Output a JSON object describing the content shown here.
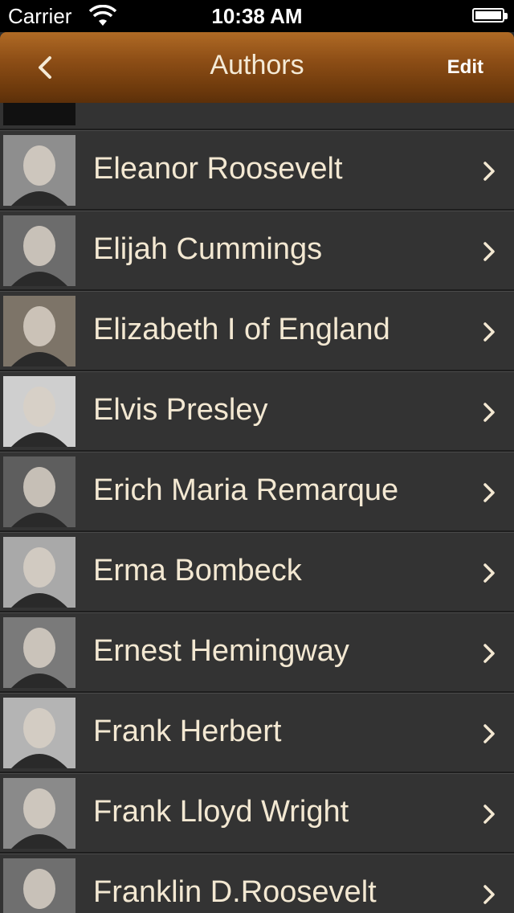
{
  "status_bar": {
    "carrier": "Carrier",
    "time": "10:38 AM"
  },
  "nav": {
    "title": "Authors",
    "edit_label": "Edit"
  },
  "authors": [
    {
      "name": "Eleanor Roosevelt"
    },
    {
      "name": "Elijah Cummings"
    },
    {
      "name": "Elizabeth I of England"
    },
    {
      "name": "Elvis Presley"
    },
    {
      "name": "Erich Maria Remarque"
    },
    {
      "name": "Erma Bombeck"
    },
    {
      "name": "Ernest Hemingway"
    },
    {
      "name": "Frank Herbert"
    },
    {
      "name": "Frank Lloyd Wright"
    },
    {
      "name": "Franklin D.Roosevelt"
    }
  ],
  "colors": {
    "nav_brown": "#8d4e16",
    "row_bg": "#333333",
    "text": "#f3e8d2"
  }
}
